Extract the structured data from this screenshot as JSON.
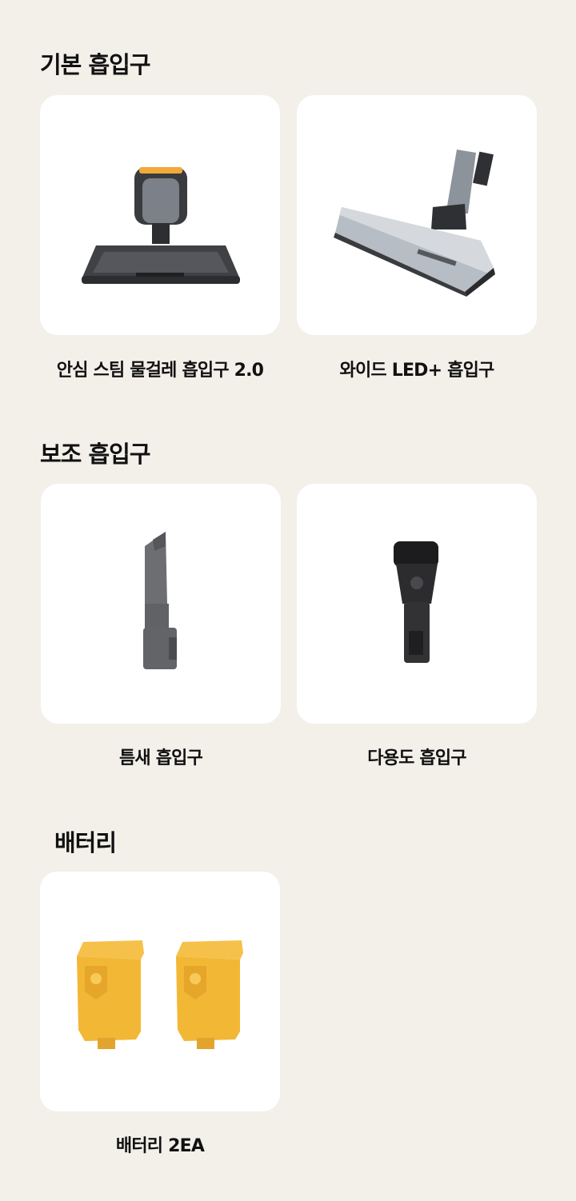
{
  "sections": [
    {
      "title": "기본 흡입구",
      "items": [
        {
          "label": "안심 스팀 물걸레 흡입구 2.0",
          "icon": "steam-mop-head-image"
        },
        {
          "label": "와이드 LED+ 흡입구",
          "icon": "wide-led-floor-head-image"
        }
      ]
    },
    {
      "title": "보조 흡입구",
      "items": [
        {
          "label": "틈새 흡입구",
          "icon": "crevice-tool-image"
        },
        {
          "label": "다용도 흡입구",
          "icon": "multi-brush-tool-image"
        }
      ]
    },
    {
      "title": "배터리",
      "items": [
        {
          "label": "배터리 2EA",
          "icon": "battery-pack-image"
        }
      ]
    }
  ],
  "colors": {
    "background": "#f3f0ea",
    "card": "#ffffff",
    "battery_yellow": "#f2b735",
    "accent_orange": "#f0a93a"
  }
}
